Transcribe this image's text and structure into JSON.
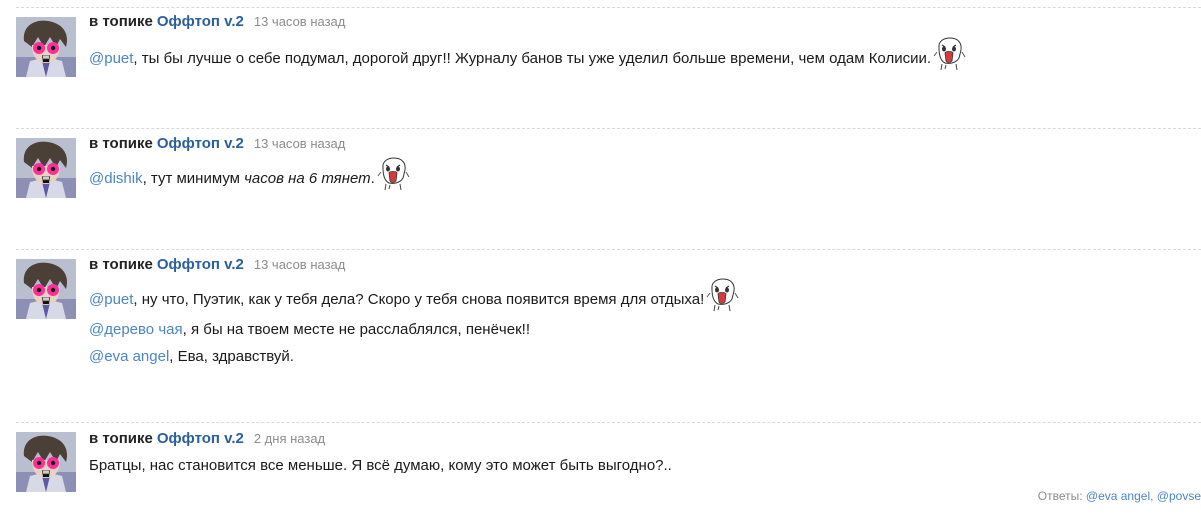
{
  "posts": [
    {
      "in_topic": "в топике",
      "topic": "Оффтоп v.2",
      "time": "13 часов назад",
      "line1": {
        "mention": "@puet",
        "text": ", ты бы лучше о себе подумал, дорогой друг!! Журналу банов ты уже уделил больше времени, чем одам Колисии."
      }
    },
    {
      "in_topic": "в топике",
      "topic": "Оффтоп v.2",
      "time": "13 часов назад",
      "line1": {
        "mention": "@dishik",
        "text_a": ", тут минимум ",
        "text_italic": "часов на 6 тянет",
        "text_b": "."
      }
    },
    {
      "in_topic": "в топике",
      "topic": "Оффтоп v.2",
      "time": "13 часов назад",
      "line1": {
        "mention": "@puet",
        "text": ", ну что, Пуэтик, как у тебя дела? Скоро у тебя снова появится время для отдыха!"
      },
      "line2": {
        "mention": "@дерево чая",
        "text": ", я бы на твоем месте не расслаблялся, пенёчек!!"
      },
      "line3": {
        "mention": "@eva angel",
        "text": ", Ева, здравствуй."
      }
    },
    {
      "in_topic": "в топике",
      "topic": "Оффтоп v.2",
      "time": "2 дня назад",
      "line1": {
        "text": "Братцы, нас становится все меньше. Я всё думаю, кому это может быть выгодно?.."
      }
    }
  ],
  "replies": {
    "label": "Ответы: ",
    "items": [
      "@eva angel",
      "@povse"
    ],
    "sep": ", "
  },
  "colors": {
    "topic": "#2a5f9e",
    "mention": "#4a86c5",
    "meta_time": "#8c8c8c",
    "separator": "#d9d9d9"
  },
  "icons": {
    "avatar": "user-avatar",
    "emoticon": "screaming-smile-icon"
  }
}
